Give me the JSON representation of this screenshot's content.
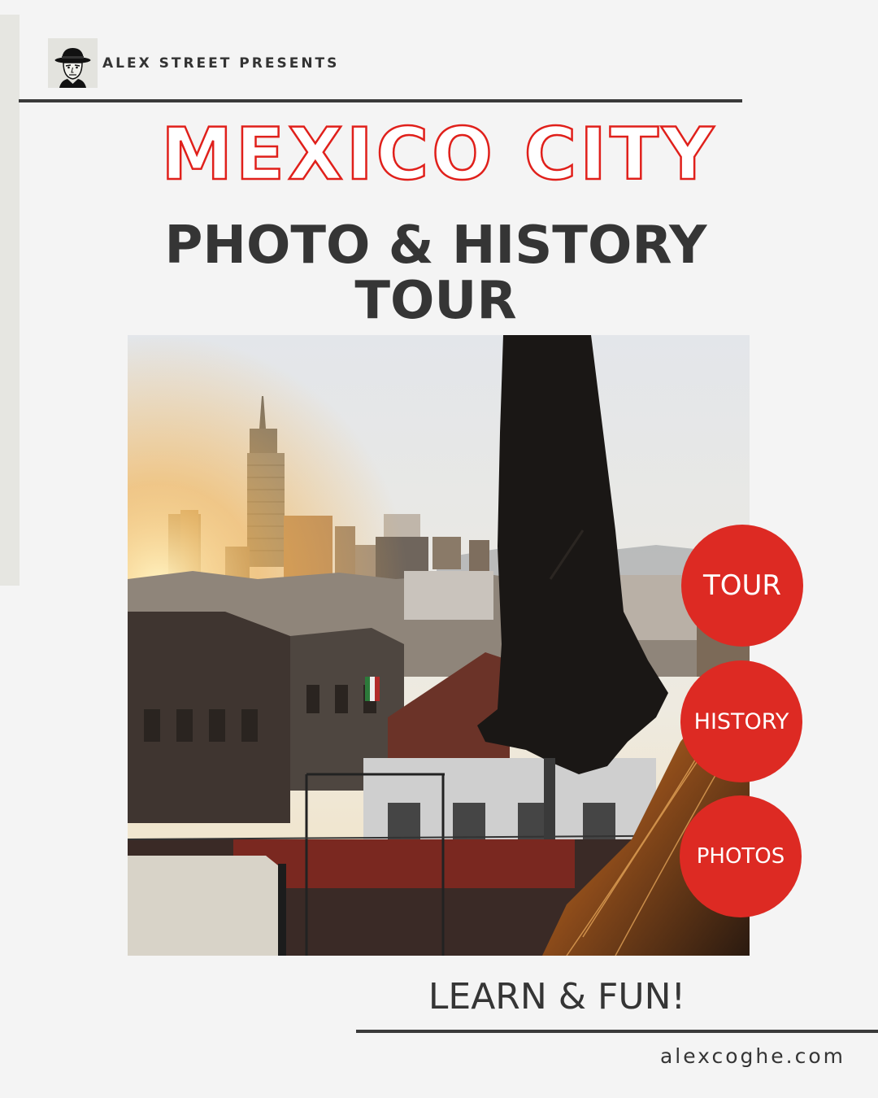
{
  "header": {
    "presenter": "ALEX STREET PRESENTS",
    "logo_icon": "man-in-fedora-icon"
  },
  "title": {
    "city": "MEXICO CITY",
    "line1": "PHOTO & HISTORY",
    "line2": "TOUR"
  },
  "photo": {
    "description_icon": "mexico-city-rooftop-photo"
  },
  "badges": [
    "TOUR",
    "HISTORY",
    "PHOTOS"
  ],
  "tagline": "LEARN & FUN!",
  "website": "alexcoghe.com",
  "colors": {
    "accent": "#dd2a23",
    "text": "#353535",
    "background": "#f4f4f4"
  }
}
